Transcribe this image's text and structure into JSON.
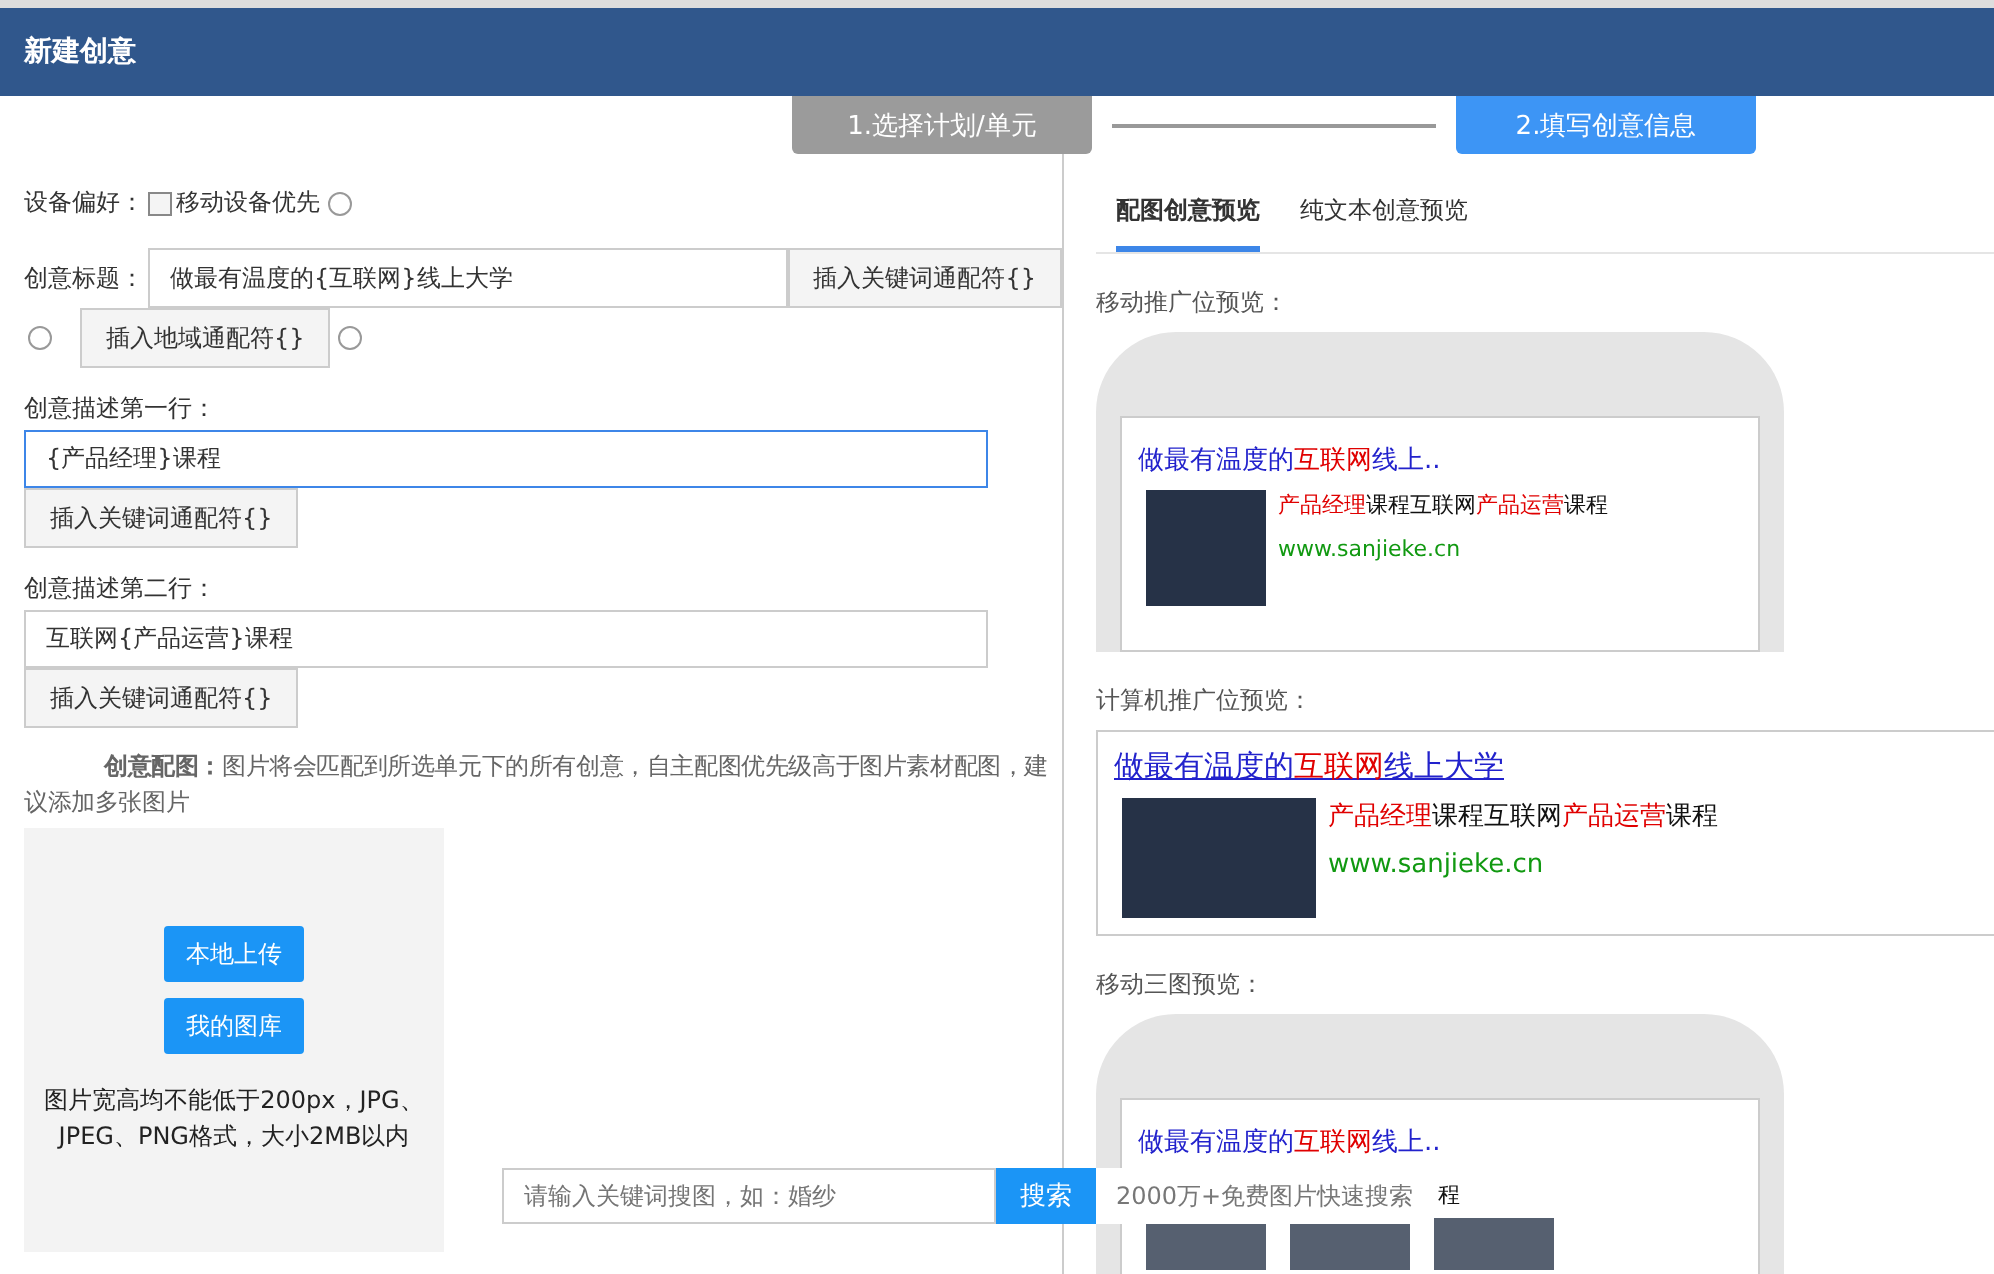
{
  "dialog": {
    "title": "新建创意"
  },
  "steps": [
    {
      "label": "1.选择计划/单元",
      "selected": false
    },
    {
      "label": "2.填写创意信息",
      "selected": true
    }
  ],
  "form": {
    "device_label": "设备偏好：",
    "mobile_first": {
      "label": "移动设备优先",
      "checked": false
    },
    "title_label": "创意标题：",
    "title_value": "做最有温度的{互联网}线上大学",
    "title_keyword_button": "插入关键词通配符{}",
    "region_button": "插入地域通配符{}",
    "desc1_label": "创意描述第一行：",
    "desc1_value": "{产品经理}课程",
    "desc1_focused": true,
    "desc1_button": "插入关键词通配符{}",
    "desc2_label": "创意描述第二行：",
    "desc2_value": "互联网{产品运营}课程",
    "desc2_focused": false,
    "desc2_button": "插入关键词通配符{}",
    "image_label": "创意配图：",
    "image_hint": "图片将会匹配到所选单元下的所有创意，自主配图优先级高于图片素材配图，建议添加多张图片",
    "upload_buttons": [
      "本地上传",
      "我的图库"
    ],
    "upload_note": "图片宽高均不能低于200px，JPG、JPEG、PNG格式，大小2MB以内",
    "image_search": {
      "placeholder": "请输入关键词搜图，如：婚纱",
      "button": "搜索",
      "tip": "2000万+免费图片快速搜索"
    }
  },
  "preview_tabs": [
    {
      "label": "配图创意预览",
      "selected": true
    },
    {
      "label": "纯文本创意预览",
      "selected": false
    }
  ],
  "previews": [
    {
      "kind": "mobile",
      "label": "移动推广位预览：",
      "title_parts": [
        {
          "text": "做最有温度的",
          "highlight": false
        },
        {
          "text": "互联网",
          "highlight": true
        },
        {
          "text": "线上..",
          "highlight": false
        }
      ],
      "desc_parts": [
        {
          "text": "产品经理",
          "highlight": true
        },
        {
          "text": "课程互联网",
          "highlight": false
        },
        {
          "text": "产品运营",
          "highlight": true
        },
        {
          "text": "课程",
          "highlight": false
        }
      ],
      "url": "www.sanjieke.cn"
    },
    {
      "kind": "desktop",
      "label": "计算机推广位预览：",
      "title_parts": [
        {
          "text": "做最有温度的",
          "highlight": false
        },
        {
          "text": "互联网",
          "highlight": true
        },
        {
          "text": "线上大学",
          "highlight": false
        }
      ],
      "desc_parts": [
        {
          "text": "产品经理",
          "highlight": true
        },
        {
          "text": "课程互联网",
          "highlight": false
        },
        {
          "text": "产品运营",
          "highlight": true
        },
        {
          "text": "课程",
          "highlight": false
        }
      ],
      "url": "www.sanjieke.cn"
    },
    {
      "kind": "three",
      "label": "移动三图预览：",
      "title_parts": [
        {
          "text": "做最有温度的",
          "highlight": false
        },
        {
          "text": "互联网",
          "highlight": true
        },
        {
          "text": "线上..",
          "highlight": false
        }
      ],
      "desc_parts": [
        {
          "text": "程",
          "highlight": false
        }
      ]
    }
  ]
}
